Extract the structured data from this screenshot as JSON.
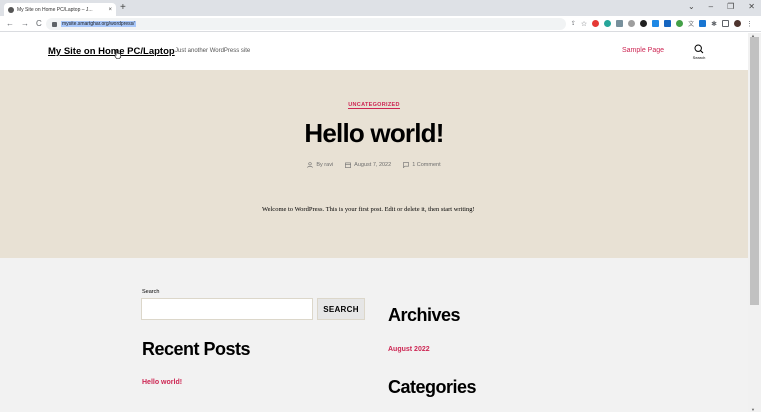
{
  "browser": {
    "tab_title": "My Site on Home PC/Laptop – J...",
    "tab_close": "×",
    "new_tab": "+",
    "back": "←",
    "forward": "→",
    "reload": "C",
    "url": "mysite.smartghar.org/wordpress/",
    "window_controls": [
      "⌄",
      "–",
      "❐",
      "✕"
    ]
  },
  "site": {
    "title": "My Site on Home PC/Laptop",
    "tagline": "Just another WordPress site",
    "nav_sample_page": "Sample Page",
    "search_label": "Search"
  },
  "post": {
    "category": "UNCATEGORIZED",
    "title": "Hello world!",
    "author": "By ravi",
    "date": "August 7, 2022",
    "comments": "1 Comment",
    "content": "Welcome to WordPress. This is your first post. Edit or delete it, then start writing!"
  },
  "widgets": {
    "search_label": "Search",
    "search_placeholder": "",
    "search_button": "SEARCH",
    "recent_posts_heading": "Recent Posts",
    "recent_posts": [
      "Hello world!"
    ],
    "archives_heading": "Archives",
    "archives": [
      "August 2022"
    ],
    "categories_heading": "Categories"
  },
  "colors": {
    "accent": "#cd2653",
    "hero_bg": "#e8e1d4",
    "widgets_bg": "#f2f2f2"
  }
}
